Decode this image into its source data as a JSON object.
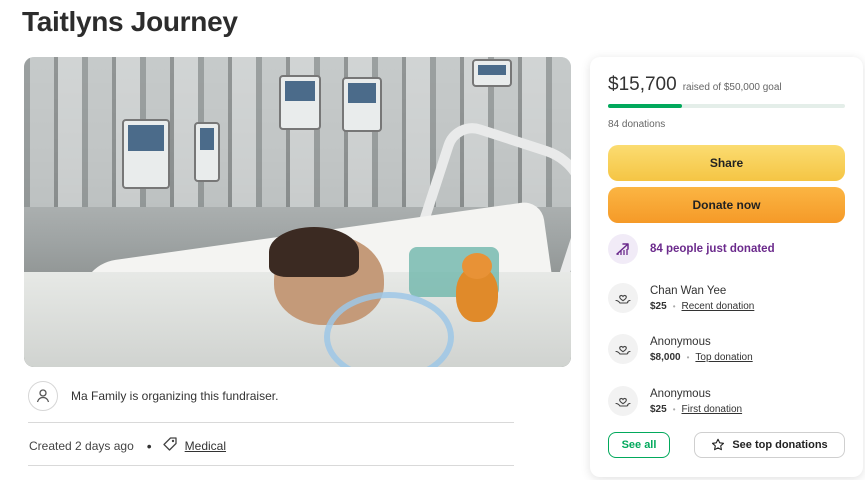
{
  "page": {
    "title": "Taitlyns Journey"
  },
  "hero_image": {
    "description_icon": "hospital-photo"
  },
  "organizer": {
    "text": "Ma Family is organizing this fundraiser.",
    "icon": "user-icon"
  },
  "meta": {
    "created": "Created 2 days ago",
    "separator": "•",
    "category": "Medical",
    "category_icon": "tag-icon"
  },
  "donation_card": {
    "raised_amount": "$15,700",
    "goal_text": "raised of $50,000 goal",
    "progress_fraction": 0.314,
    "donation_count": "84 donations",
    "share_label": "Share",
    "donate_label": "Donate now",
    "trending_text": "84 people just donated",
    "trending_icon": "trending-up-icon",
    "donors": [
      {
        "name": "Chan Wan Yee",
        "amount": "$25",
        "type": "Recent donation",
        "icon": "heart-hands-icon"
      },
      {
        "name": "Anonymous",
        "amount": "$8,000",
        "type": "Top donation",
        "icon": "heart-hands-icon"
      },
      {
        "name": "Anonymous",
        "amount": "$25",
        "type": "First donation",
        "icon": "heart-hands-icon"
      }
    ],
    "separator": "•",
    "see_all_label": "See all",
    "see_top_label": "See top donations",
    "see_top_icon": "star-icon"
  },
  "colors": {
    "accent_green": "#02a95c",
    "share_yellow": "#f8cf55",
    "donate_orange": "#f7a633",
    "trending_purple": "#6b2a8c"
  }
}
